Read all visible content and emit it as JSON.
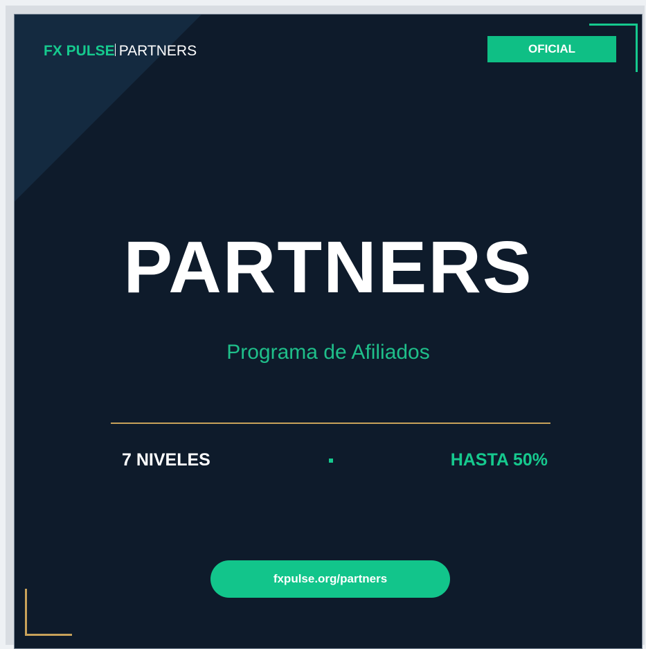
{
  "brand": {
    "name": "FX PULSE",
    "sub": "PARTNERS"
  },
  "badge": "OFICIAL",
  "title": "PARTNERS",
  "subtitle": "Programa de Afiliados",
  "stats": {
    "left": "7 NIVELES",
    "right": "HASTA 50%"
  },
  "link": "fxpulse.org/partners",
  "colors": {
    "background": "#0e1b2b",
    "accent_green": "#16c98e",
    "accent_gold": "#c8a25a",
    "text_white": "#ffffff"
  }
}
